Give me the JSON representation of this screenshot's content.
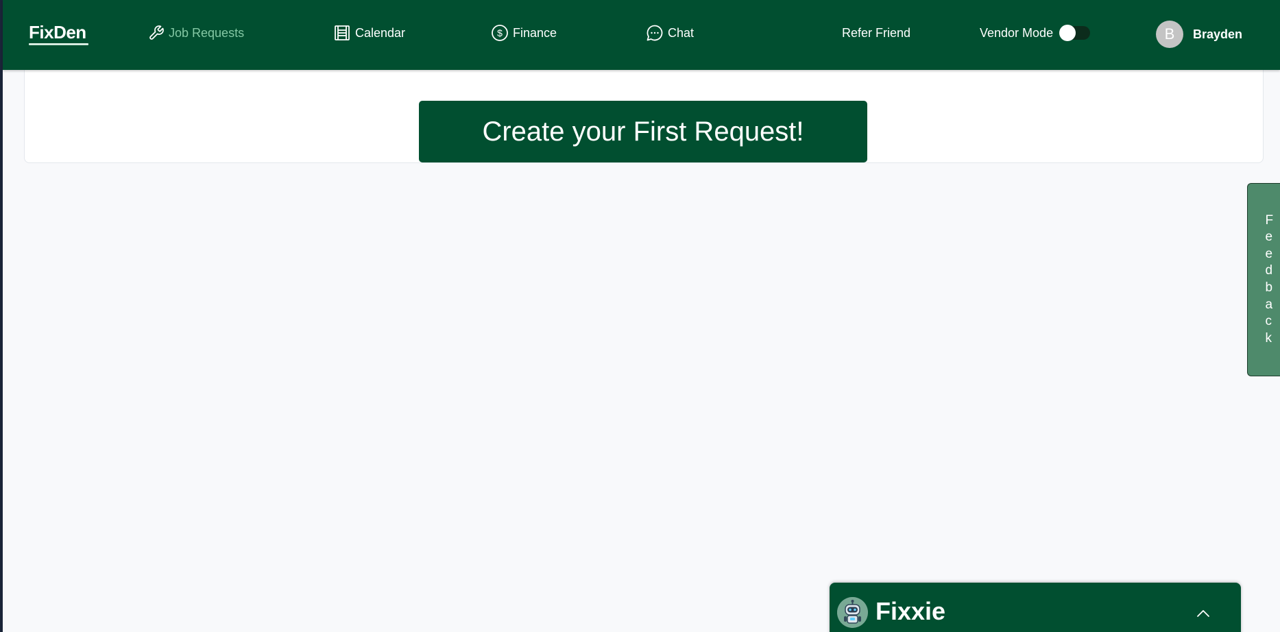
{
  "app": {
    "logo": "FixDen"
  },
  "nav": {
    "job_requests": "Job Requests",
    "calendar": "Calendar",
    "finance": "Finance",
    "chat": "Chat",
    "refer_friend": "Refer Friend",
    "vendor_mode_label": "Vendor Mode",
    "vendor_mode_on": false
  },
  "user": {
    "initial": "B",
    "name": "Brayden"
  },
  "main": {
    "cta_label": "Create your First Request!"
  },
  "feedback": {
    "letters": [
      "F",
      "e",
      "e",
      "d",
      "b",
      "a",
      "c",
      "k"
    ]
  },
  "fixxie": {
    "title": "Fixxie"
  },
  "colors": {
    "brand_green": "#014f30",
    "active_link": "#84c8a4",
    "feedback_tab": "#4e8a6b",
    "page_background": "#f8f9fb"
  },
  "icons": {
    "job_requests": "wrench-icon",
    "calendar": "calendar-icon",
    "finance": "dollar-circle-icon",
    "chat": "chat-bubble-icon",
    "fixxie": "robot-icon",
    "fixxie_toggle": "chevron-up-icon"
  }
}
